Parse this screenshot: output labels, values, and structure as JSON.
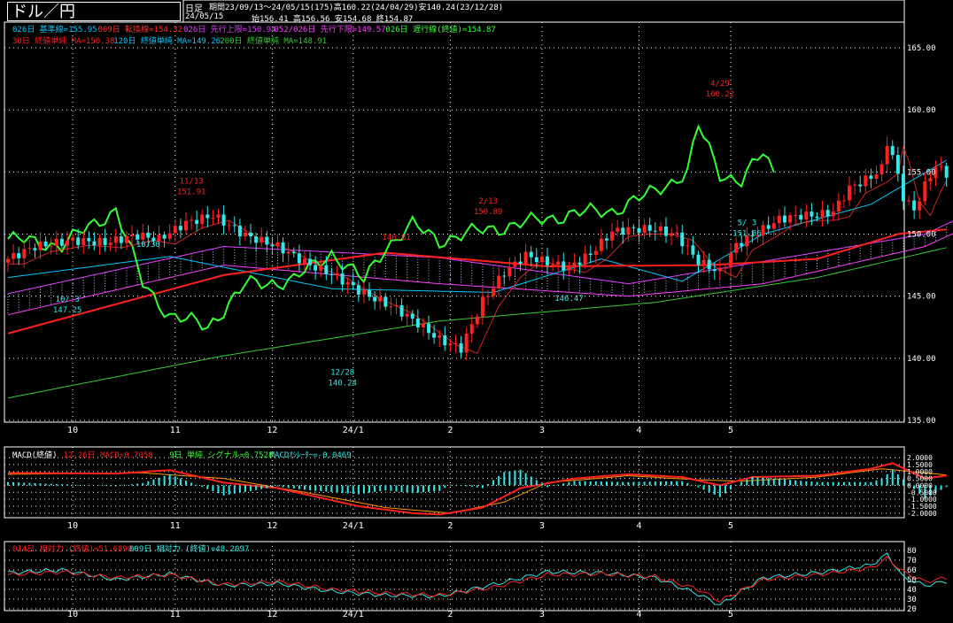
{
  "header": {
    "pair_label": "ドル／円",
    "timeframe": "日足",
    "period_line": "期間23/09/13～24/05/15(175)高160.22(24/04/29)安140.24(23/12/28)",
    "last_date": "24/05/15",
    "ohlc_line": "始156.41 高156.56 安154.68 終154.87"
  },
  "colors": {
    "bg": "#000000",
    "frame": "#ffffff",
    "grid": "#ffffff",
    "up": "#ff2020",
    "down": "#33e8e8",
    "text": "#ffffff",
    "kijun": "#00c8ff",
    "tenkan": "#ff3030",
    "senkouA": "#e040ff",
    "senkouB": "#ff40ff",
    "chikou": "#33ff33",
    "ma30": "#ff2020",
    "ma120": "#00c8ff",
    "ma200": "#33cc33",
    "macd": "#ff2020",
    "signal": "#ff9900",
    "hist": "#33e8e8",
    "rsi14": "#ff2020",
    "rsi9": "#33e8e8"
  },
  "legends": {
    "ichimoku": [
      {
        "text": "026日 基準線=155.95",
        "color": "#00c8ff"
      },
      {
        "text": "009日 転換線=154.32",
        "color": "#ff3030"
      },
      {
        "text": "026日 先行上限=150.94",
        "color": "#e040ff"
      },
      {
        "text": "052/026日 先行下限=149.57",
        "color": "#ff40ff"
      },
      {
        "text": "026日 遅行線(終値)=154.87",
        "color": "#33ff33"
      }
    ],
    "ma": [
      {
        "text": "30日 終値単純 MA=150.38",
        "color": "#ff2020"
      },
      {
        "text": "120日 終値単純 MA=149.26",
        "color": "#00c8ff"
      },
      {
        "text": "200日 終値単純 MA=148.91",
        "color": "#33cc33"
      }
    ],
    "macd": [
      {
        "text": "MACD(終値)",
        "color": "#ffffff"
      },
      {
        "text": "12-26日 MACD=0.7058",
        "color": "#ff2020"
      },
      {
        "text": "9日 単純 シグナル=0.7528",
        "color": "#33ff33"
      },
      {
        "text": "MACDｵｼﾚｰﾀｰ=-0.0469",
        "color": "#33e8e8"
      }
    ],
    "rsi": [
      {
        "text": "014日 相対力 (終値)=51.6899",
        "color": "#ff2020"
      },
      {
        "text": "009日 相対力 (終値)=48.2097",
        "color": "#33e8e8"
      }
    ]
  },
  "chart_data": [
    {
      "type": "candlestick",
      "title": "ドル／円",
      "ylim": [
        135,
        166
      ],
      "y_ticks": [
        "165.00",
        "160.00",
        "155.00",
        "150.00",
        "145.00",
        "140.00",
        "135.00"
      ],
      "x_ticks": [
        "10",
        "11",
        "12",
        "24/1",
        "2",
        "3",
        "4",
        "5"
      ],
      "annotations": [
        {
          "text": "10/ 3",
          "value": 147.25
        },
        {
          "text": "147.25",
          "value": 147.25
        },
        {
          "text": "10/30",
          "value": 149.98
        },
        {
          "text": "11/13",
          "value": 151.91
        },
        {
          "text": "151.91",
          "value": 151.91
        },
        {
          "text": "148.81",
          "value": 148.81
        },
        {
          "text": "12/28",
          "value": 140.24
        },
        {
          "text": "140.24",
          "value": 140.24
        },
        {
          "text": "2/13",
          "value": 150.89
        },
        {
          "text": "150.89",
          "value": 150.89
        },
        {
          "text": "146.47",
          "value": 146.47
        },
        {
          "text": "4/29",
          "value": 160.22
        },
        {
          "text": "160.22",
          "value": 160.22
        },
        {
          "text": "5/ 3",
          "value": 151.86
        },
        {
          "text": "151.86",
          "value": 151.86
        }
      ],
      "close_anchors": [
        [
          0,
          148.0
        ],
        [
          5,
          149.0
        ],
        [
          12,
          149.5
        ],
        [
          18,
          149.3
        ],
        [
          24,
          149.9
        ],
        [
          28,
          149.6
        ],
        [
          33,
          150.9
        ],
        [
          38,
          151.5
        ],
        [
          44,
          149.9
        ],
        [
          50,
          149.0
        ],
        [
          56,
          147.5
        ],
        [
          60,
          146.8
        ],
        [
          66,
          145.2
        ],
        [
          72,
          144.0
        ],
        [
          76,
          142.8
        ],
        [
          80,
          141.5
        ],
        [
          84,
          140.8
        ],
        [
          88,
          144.6
        ],
        [
          92,
          146.9
        ],
        [
          96,
          148.3
        ],
        [
          100,
          147.7
        ],
        [
          104,
          147.3
        ],
        [
          108,
          148.4
        ],
        [
          112,
          150.2
        ],
        [
          116,
          150.4
        ],
        [
          120,
          150.4
        ],
        [
          124,
          149.9
        ],
        [
          128,
          147.8
        ],
        [
          132,
          146.9
        ],
        [
          135,
          149.1
        ],
        [
          139,
          150.1
        ],
        [
          143,
          151.2
        ],
        [
          147,
          151.5
        ],
        [
          150,
          151.5
        ],
        [
          153,
          151.8
        ],
        [
          156,
          153.7
        ],
        [
          160,
          154.6
        ],
        [
          162,
          155.3
        ],
        [
          163,
          157.4
        ],
        [
          164,
          156.3
        ],
        [
          166,
          153.0
        ],
        [
          168,
          151.9
        ],
        [
          170,
          153.9
        ],
        [
          172,
          155.5
        ],
        [
          174,
          154.87
        ]
      ],
      "ma30_anchors": [
        [
          0,
          142.0
        ],
        [
          40,
          146.7
        ],
        [
          70,
          148.5
        ],
        [
          100,
          147.4
        ],
        [
          130,
          147.5
        ],
        [
          150,
          148.0
        ],
        [
          165,
          150.0
        ],
        [
          174,
          150.38
        ]
      ],
      "ma200_anchors": [
        [
          0,
          136.8
        ],
        [
          40,
          140.2
        ],
        [
          80,
          143.0
        ],
        [
          120,
          144.5
        ],
        [
          150,
          146.5
        ],
        [
          174,
          148.91
        ]
      ],
      "kijun_anchors": [
        [
          0,
          146.5
        ],
        [
          30,
          148.2
        ],
        [
          60,
          145.6
        ],
        [
          90,
          145.3
        ],
        [
          110,
          148.0
        ],
        [
          125,
          146.2
        ],
        [
          140,
          150.0
        ],
        [
          160,
          152.4
        ],
        [
          174,
          155.95
        ]
      ],
      "senkou_a_anchors": [
        [
          0,
          145.2
        ],
        [
          40,
          149.0
        ],
        [
          80,
          148.1
        ],
        [
          115,
          146.0
        ],
        [
          140,
          147.8
        ],
        [
          170,
          150.0
        ],
        [
          185,
          153.0
        ],
        [
          200,
          155.0
        ]
      ],
      "senkou_b_anchors": [
        [
          0,
          143.5
        ],
        [
          40,
          147.5
        ],
        [
          80,
          146.0
        ],
        [
          115,
          145.0
        ],
        [
          140,
          146.0
        ],
        [
          170,
          149.0
        ],
        [
          185,
          152.0
        ],
        [
          200,
          153.5
        ]
      ],
      "chikou_anchors": [
        [
          0,
          149.6
        ],
        [
          10,
          149.1
        ],
        [
          20,
          152.0
        ],
        [
          25,
          146.0
        ],
        [
          30,
          143.5
        ],
        [
          37,
          142.5
        ],
        [
          44,
          145.9
        ],
        [
          53,
          146.3
        ],
        [
          60,
          148.5
        ],
        [
          66,
          146.2
        ],
        [
          70,
          149.0
        ],
        [
          75,
          150.7
        ],
        [
          80,
          149.5
        ],
        [
          88,
          150.3
        ],
        [
          96,
          150.9
        ],
        [
          104,
          151.6
        ],
        [
          112,
          151.9
        ],
        [
          118,
          153.0
        ],
        [
          122,
          154.0
        ],
        [
          126,
          155.0
        ],
        [
          128,
          158.7
        ],
        [
          132,
          154.9
        ],
        [
          136,
          154.3
        ],
        [
          140,
          156.5
        ],
        [
          142,
          154.87
        ]
      ]
    },
    {
      "type": "line",
      "title": "MACD(終値)",
      "ylim": [
        -2.2,
        2.2
      ],
      "y_ticks": [
        "2.0000",
        "1.5000",
        "1.0000",
        "0.5000",
        "0.0000",
        "-0.5000",
        "-1.0000",
        "-1.5000",
        "-2.0000"
      ],
      "x_ticks": [
        "10",
        "11",
        "12",
        "24/1",
        "2",
        "3",
        "4",
        "5"
      ],
      "series": [
        {
          "name": "12-26日 MACD",
          "anchors": [
            [
              0,
              0.9
            ],
            [
              20,
              0.85
            ],
            [
              30,
              1.1
            ],
            [
              40,
              0.2
            ],
            [
              50,
              -0.2
            ],
            [
              65,
              -1.5
            ],
            [
              75,
              -2.0
            ],
            [
              80,
              -2.1
            ],
            [
              88,
              -1.6
            ],
            [
              95,
              -0.2
            ],
            [
              105,
              0.5
            ],
            [
              115,
              0.8
            ],
            [
              125,
              0.6
            ],
            [
              132,
              0.0
            ],
            [
              138,
              0.6
            ],
            [
              150,
              0.7
            ],
            [
              160,
              1.2
            ],
            [
              164,
              1.6
            ],
            [
              170,
              0.5
            ],
            [
              174,
              0.7058
            ]
          ]
        },
        {
          "name": "9日 単純 シグナル",
          "anchors": [
            [
              0,
              0.8
            ],
            [
              25,
              0.9
            ],
            [
              40,
              0.5
            ],
            [
              55,
              -0.5
            ],
            [
              70,
              -1.6
            ],
            [
              82,
              -2.0
            ],
            [
              92,
              -1.2
            ],
            [
              100,
              0.2
            ],
            [
              115,
              0.7
            ],
            [
              128,
              0.4
            ],
            [
              136,
              0.3
            ],
            [
              150,
              0.6
            ],
            [
              162,
              1.2
            ],
            [
              170,
              0.9
            ],
            [
              174,
              0.7528
            ]
          ]
        }
      ]
    },
    {
      "type": "line",
      "title": "相対力 (終値)",
      "ylim": [
        20,
        80
      ],
      "y_ticks": [
        "80",
        "70",
        "60",
        "50",
        "40",
        "30",
        "20"
      ],
      "x_ticks": [
        "10",
        "11",
        "12",
        "24/1",
        "2",
        "3",
        "4",
        "5"
      ],
      "series": [
        {
          "name": "014日 相対力",
          "anchors": [
            [
              0,
              55
            ],
            [
              10,
              58
            ],
            [
              20,
              52
            ],
            [
              30,
              55
            ],
            [
              40,
              45
            ],
            [
              50,
              48
            ],
            [
              60,
              40
            ],
            [
              70,
              36
            ],
            [
              80,
              34
            ],
            [
              90,
              42
            ],
            [
              100,
              55
            ],
            [
              110,
              56
            ],
            [
              120,
              53
            ],
            [
              128,
              40
            ],
            [
              132,
              28
            ],
            [
              140,
              50
            ],
            [
              150,
              55
            ],
            [
              160,
              62
            ],
            [
              163,
              72
            ],
            [
              166,
              58
            ],
            [
              170,
              48
            ],
            [
              174,
              51.6899
            ]
          ]
        },
        {
          "name": "009日 相対力",
          "anchors": [
            [
              0,
              57
            ],
            [
              10,
              60
            ],
            [
              20,
              50
            ],
            [
              30,
              56
            ],
            [
              40,
              44
            ],
            [
              50,
              46
            ],
            [
              60,
              38
            ],
            [
              70,
              34
            ],
            [
              80,
              33
            ],
            [
              90,
              45
            ],
            [
              100,
              58
            ],
            [
              110,
              57
            ],
            [
              120,
              52
            ],
            [
              128,
              35
            ],
            [
              132,
              24
            ],
            [
              140,
              52
            ],
            [
              150,
              57
            ],
            [
              160,
              65
            ],
            [
              163,
              76
            ],
            [
              166,
              52
            ],
            [
              170,
              44
            ],
            [
              174,
              48.2097
            ]
          ]
        }
      ]
    }
  ]
}
